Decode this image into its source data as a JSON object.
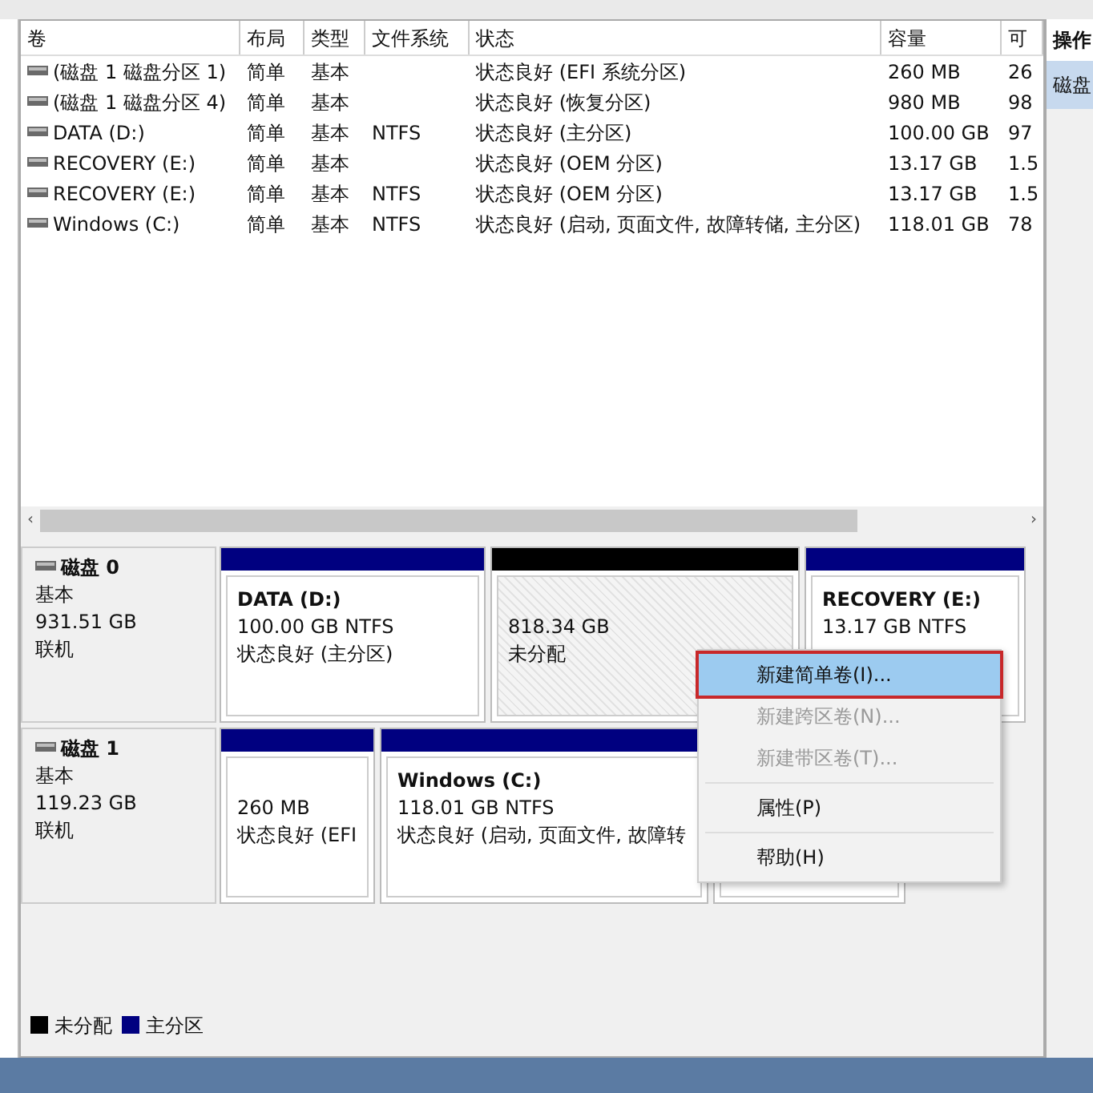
{
  "volumes_table": {
    "columns": [
      "卷",
      "布局",
      "类型",
      "文件系统",
      "状态",
      "容量",
      "可"
    ],
    "rows": [
      {
        "cells": [
          "(磁盘 1 磁盘分区 1)",
          "简单",
          "基本",
          "",
          "状态良好 (EFI 系统分区)",
          "260 MB",
          "26"
        ]
      },
      {
        "cells": [
          "(磁盘 1 磁盘分区 4)",
          "简单",
          "基本",
          "",
          "状态良好 (恢复分区)",
          "980 MB",
          "98"
        ]
      },
      {
        "cells": [
          "DATA (D:)",
          "简单",
          "基本",
          "NTFS",
          "状态良好 (主分区)",
          "100.00 GB",
          "97"
        ]
      },
      {
        "cells": [
          "RECOVERY (E:)",
          "简单",
          "基本",
          "",
          "状态良好 (OEM 分区)",
          "13.17 GB",
          "1.5"
        ]
      },
      {
        "cells": [
          "RECOVERY (E:)",
          "简单",
          "基本",
          "NTFS",
          "状态良好 (OEM 分区)",
          "13.17 GB",
          "1.5"
        ]
      },
      {
        "cells": [
          "Windows (C:)",
          "简单",
          "基本",
          "NTFS",
          "状态良好 (启动, 页面文件, 故障转储, 主分区)",
          "118.01 GB",
          "78"
        ]
      }
    ]
  },
  "disks": [
    {
      "name": "磁盘 0",
      "type": "基本",
      "size": "931.51 GB",
      "status": "联机",
      "partitions": [
        {
          "kind": "primary",
          "title": "DATA  (D:)",
          "size": "100.00 GB NTFS",
          "status": "状态良好 (主分区)"
        },
        {
          "kind": "unallocated",
          "size": "818.34 GB",
          "status": "未分配"
        },
        {
          "kind": "primary",
          "title": "RECOVERY  (E:)",
          "size": "13.17 GB NTFS"
        }
      ]
    },
    {
      "name": "磁盘 1",
      "type": "基本",
      "size": "119.23 GB",
      "status": "联机",
      "partitions": [
        {
          "kind": "primary",
          "size": "260 MB",
          "status": "状态良好 (EFI"
        },
        {
          "kind": "primary",
          "title": "Windows  (C:)",
          "size": "118.01 GB NTFS",
          "status": "状态良好 (启动, 页面文件, 故障转"
        },
        {
          "kind": "covered"
        }
      ]
    }
  ],
  "legend": [
    {
      "label": "未分配",
      "color": "#000000"
    },
    {
      "label": "主分区",
      "color": "#000080"
    }
  ],
  "context_menu": {
    "items": [
      {
        "kind": "item",
        "label": "新建简单卷(I)...",
        "disabled": false,
        "selected": true
      },
      {
        "kind": "item",
        "label": "新建跨区卷(N)...",
        "disabled": true,
        "selected": false
      },
      {
        "kind": "item",
        "label": "新建带区卷(T)...",
        "disabled": true,
        "selected": false
      },
      {
        "kind": "separator"
      },
      {
        "kind": "item",
        "label": "属性(P)",
        "disabled": false,
        "selected": false
      },
      {
        "kind": "separator"
      },
      {
        "kind": "item",
        "label": "帮助(H)",
        "disabled": false,
        "selected": false
      }
    ]
  },
  "scrollbar": {
    "left_arrow": "‹",
    "right_arrow": "›"
  },
  "actions_panel": {
    "title": "操作",
    "items": [
      {
        "label": "磁盘",
        "selected": true
      }
    ]
  }
}
